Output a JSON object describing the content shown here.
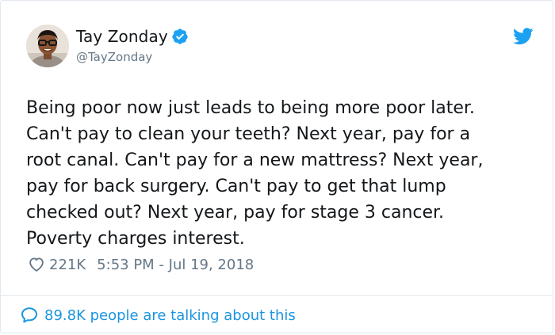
{
  "tweet": {
    "author": {
      "display_name": "Tay Zonday",
      "handle": "@TayZonday",
      "verified": true
    },
    "text": "Being poor now just leads to being more poor later.\nCan't pay to clean your teeth? Next year, pay for a\nroot canal. Can't pay for a new mattress? Next year,\npay for back surgery. Can't pay to get that lump\nchecked out? Next year, pay for stage 3 cancer.\nPoverty charges interest.",
    "likes": "221K",
    "timestamp": "5:53 PM - Jul 19, 2018",
    "conversation": "89.8K people are talking about this"
  },
  "colors": {
    "brand": "#1da1f2",
    "link": "#1b95e0",
    "secondary_text": "#657786"
  },
  "icons": {
    "brand": "twitter-bird-icon",
    "verified": "verified-badge-icon",
    "like": "heart-icon",
    "conversation": "speech-bubble-icon"
  }
}
